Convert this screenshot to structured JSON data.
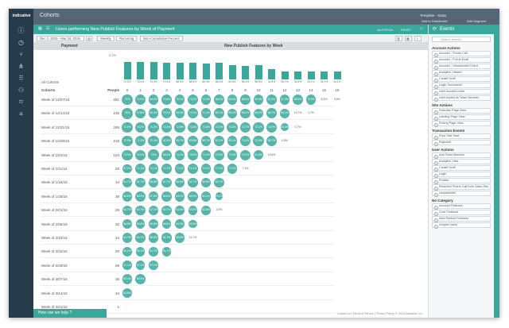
{
  "brand": "indicative",
  "page_title": "Cohorts",
  "top_right": {
    "template": "Template - SaaS",
    "add_dashboard": "Add to Dashboard",
    "add_segment": "Add Segment"
  },
  "query_title": "Users performing New Publish Features by Week of Payment",
  "title_actions": {
    "autorun": "AUTORUN",
    "reset": "RESET"
  },
  "controls": {
    "date_range": "Dec 1, 2015 - Mar 16, 2016",
    "interval": "Weekly",
    "mode": "Recurring",
    "metric": "Non-Cumulative Percent"
  },
  "header": {
    "left": "Payment",
    "right": "New Publish Features by Week"
  },
  "all_cohorts_label": "All Cohorts",
  "cohorts_label": "Cohorts",
  "people_label": "People",
  "chart_data": {
    "type": "table",
    "weeks": [
      "0",
      "1",
      "2",
      "3",
      "4",
      "5",
      "6",
      "7",
      "8",
      "9",
      "10",
      "11",
      "12",
      "13",
      "14",
      "15",
      "16"
    ],
    "all_cohorts": [
      "72.2%",
      "73.4%",
      "73.4%",
      "70.4%",
      "68.9%",
      "68.5%",
      "66.4%",
      "68.4%",
      "60.8%",
      "55.4%",
      "58.8%",
      "42.6%",
      "34.7%",
      "34.6%",
      "34.1%",
      "34.1%",
      "34.1%"
    ],
    "rows": [
      {
        "label": "Week of 12/07/15",
        "people": "281",
        "values": [
          "72%",
          "71.9%",
          "69.0%",
          "70.6%",
          "70.1%",
          "71.2%",
          "70.3%",
          "69.0%",
          "69.6%",
          "65.5%",
          "69.6%",
          "67.3%",
          "67.3%",
          "68.9%",
          "70.5%",
          "5.3%",
          "5.8%"
        ]
      },
      {
        "label": "Week of 12/14/15",
        "people": "236",
        "values": [
          "78%",
          "67.8%",
          "69.0%",
          "70.2%",
          "69.5%",
          "71.0%",
          "71.4%",
          "69.1%",
          "68.2%",
          "68.2%",
          "68.2%",
          "68.7%",
          "66.1%",
          "13.7%",
          "1.7%",
          "",
          ""
        ]
      },
      {
        "label": "Week of 12/21/15",
        "people": "289",
        "values": [
          "72.9%",
          "70.2%",
          "73.2%",
          "72.4%",
          "72.6%",
          "72.6%",
          "73.8%",
          "72.0%",
          "73.2%",
          "72.7%",
          "72.1%",
          "72.9%",
          "26.4%",
          "0.7%",
          "",
          "",
          ""
        ]
      },
      {
        "label": "Week of 12/28/15",
        "people": "218",
        "values": [
          "72.9%",
          "71.3%",
          "72.4%",
          "67.9%",
          "69.7%",
          "63.8%",
          "69.7%",
          "67.0%",
          "65.1%",
          "72.4%",
          "72.9%",
          "69.7%",
          "0.8%",
          "",
          "",
          "",
          ""
        ]
      },
      {
        "label": "Week of 1/04/16",
        "people": "104",
        "values": [
          "73.0%",
          "74.0%",
          "79%",
          "69.2%",
          "71.2%",
          "75.0%",
          "71.2%",
          "70.2%",
          "71.2%",
          "71.2%",
          "61.5%",
          "10.6%",
          "",
          "",
          "",
          "",
          ""
        ]
      },
      {
        "label": "Week of 1/11/16",
        "people": "28",
        "values": [
          "57.1%",
          "71.1%",
          "71.1%",
          "71.1%",
          "71.1%",
          "71.1%",
          "71.1%",
          "71.1%",
          "71.1%",
          "7.1%",
          "",
          "",
          "",
          "",
          "",
          "",
          ""
        ]
      },
      {
        "label": "Week of 1/18/16",
        "people": "34",
        "values": [
          "61.7%",
          "61.7%",
          "58.8%",
          "61.7%",
          "58.8%",
          "61.7%",
          "58.8%",
          "61.7%",
          "",
          "",
          "",
          "",
          "",
          "",
          "",
          "",
          ""
        ]
      },
      {
        "label": "Week of 1/25/16",
        "people": "39",
        "values": [
          "66.6%",
          "69.2%",
          "57.8%",
          "66.6%",
          "64.1%",
          "69.2%",
          "64.1%",
          "23.1%",
          "",
          "",
          "",
          "",
          "",
          "",
          "",
          "",
          ""
        ]
      },
      {
        "label": "Week of 2/01/16",
        "people": "28",
        "values": [
          "60.7%",
          "60.7%",
          "57.1%",
          "60.7%",
          "53.5%",
          "53.5%",
          "53.5%",
          "2.9%",
          "",
          "",
          "",
          "",
          "",
          "",
          "",
          "",
          ""
        ]
      },
      {
        "label": "Week of 2/08/16",
        "people": "30",
        "values": [
          "56.6%",
          "56.6%",
          "56.6%",
          "56.6%",
          "53.3%",
          "33.3%",
          "",
          "",
          "",
          "",
          "",
          "",
          "",
          "",
          "",
          "",
          ""
        ]
      },
      {
        "label": "Week of 2/15/16",
        "people": "34",
        "values": [
          "64.7%",
          "64.7%",
          "58.8%",
          "61.7%",
          "58.8%",
          "11.7%",
          "",
          "",
          "",
          "",
          "",
          "",
          "",
          "",
          "",
          "",
          ""
        ]
      },
      {
        "label": "Week of 2/22/16",
        "people": "29",
        "values": [
          "55.1%",
          "55.1%",
          "51.7%",
          "51.7%",
          "",
          "",
          "",
          "",
          "",
          "",
          "",
          "",
          "",
          "",
          "",
          "",
          ""
        ]
      },
      {
        "label": "Week of 2/29/16",
        "people": "28",
        "values": [
          "57.1%",
          "57.1%",
          "57.1%",
          "",
          "",
          "",
          "",
          "",
          "",
          "",
          "",
          "",
          "",
          "",
          "",
          "",
          ""
        ]
      },
      {
        "label": "Week of 3/07/16",
        "people": "36",
        "values": [
          "69.4%",
          "69.4%",
          "",
          "",
          "",
          "",
          "",
          "",
          "",
          "",
          "",
          "",
          "",
          "",
          "",
          "",
          ""
        ]
      },
      {
        "label": "Week of 3/14/16",
        "people": "34",
        "values": [
          "61.8%",
          "",
          "",
          "",
          "",
          "",
          "",
          "",
          "",
          "",
          "",
          "",
          "",
          "",
          "",
          "",
          ""
        ]
      },
      {
        "label": "Week of 3/21/16",
        "people": "1",
        "values": [
          "-",
          "",
          "",
          "",
          "",
          "",
          "",
          "",
          "",
          "",
          "",
          "",
          "",
          "",
          "",
          "",
          ""
        ]
      }
    ]
  },
  "events": {
    "title": "Events",
    "search_placeholder": "Search events",
    "sections": [
      {
        "name": "Account Actions",
        "items": [
          "Account - Phone Call",
          "Account - Pull-in Draft",
          "Account - Unsubscribe Event",
          "Analytics Viewed",
          "Create Draft",
          "Login Successful",
          "User Accepts Invite",
          "User Added as Team Member"
        ]
      },
      {
        "name": "Site Actions",
        "items": [
          "Features Page View",
          "Landing Page View",
          "Pricing Page View"
        ]
      },
      {
        "name": "Transaction Events",
        "items": [
          "Free Trial Start",
          "Payment"
        ]
      },
      {
        "name": "User Actions",
        "items": [
          "Add Team Member",
          "Analytics View",
          "Create Draft",
          "Login",
          "Publish",
          "Receives Phone Call from Sales Rep",
          "Unsubscribe"
        ]
      },
      {
        "name": "No Category",
        "items": [
          "Account Features",
          "Core Features",
          "New Publish Features",
          "Unique Users"
        ]
      }
    ]
  },
  "help": "How can we help ?",
  "footer": "Contact Us  |  Terms of Service  |  Privacy Policy  |  © 2016 Indicative, Inc."
}
